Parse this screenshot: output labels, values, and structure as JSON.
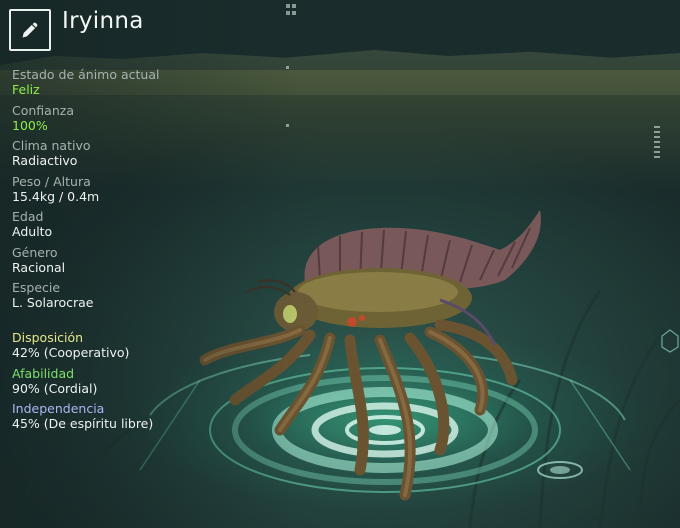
{
  "creature": {
    "name": "Iryinna",
    "edit_icon": "pencil-icon"
  },
  "stats": [
    {
      "label": "Estado de ánimo actual",
      "value": "Feliz",
      "highlight": true
    },
    {
      "label": "Confianza",
      "value": "100%",
      "highlight": true
    },
    {
      "label": "Clima nativo",
      "value": "Radiactivo",
      "highlight": false
    },
    {
      "label": "Peso / Altura",
      "value": "15.4kg / 0.4m",
      "highlight": false
    },
    {
      "label": "Edad",
      "value": "Adulto",
      "highlight": false
    },
    {
      "label": "Género",
      "value": "Racional",
      "highlight": false
    },
    {
      "label": "Especie",
      "value": "L. Solarocrae",
      "highlight": false
    }
  ],
  "traits": [
    {
      "label": "Disposición",
      "value": "42% (Cooperativo)",
      "color": "#e6e58a"
    },
    {
      "label": "Afabilidad",
      "value": "90% (Cordial)",
      "color": "#7fe06a"
    },
    {
      "label": "Independencia",
      "value": "45% (De espíritu libre)",
      "color": "#a9b8f2"
    }
  ],
  "colors": {
    "accent_green": "#8df04b",
    "text": "#eef2f0",
    "label": "#a7b2af",
    "holo": "#7ef0c8"
  }
}
